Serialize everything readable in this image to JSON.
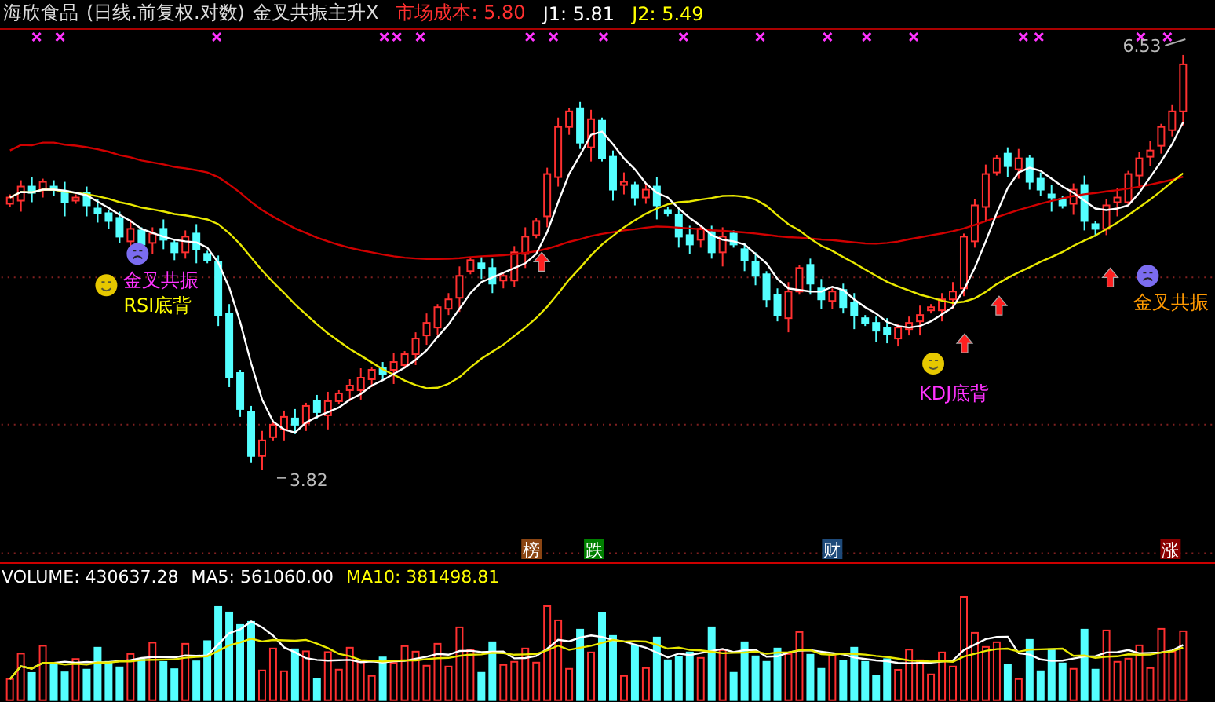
{
  "header": {
    "stock": "海欣食品",
    "period": "(日线.前复权.对数)",
    "indicator": "金叉共振主升X",
    "readings": [
      {
        "label": "市场成本:",
        "value": "5.80",
        "color": "#ff3030"
      },
      {
        "label": "J1:",
        "value": "5.81",
        "color": "#ffffff"
      },
      {
        "label": "J2:",
        "value": "5.49",
        "color": "#ffff00"
      }
    ]
  },
  "price_chart": {
    "high_label": "6.53",
    "low_label": "3.82",
    "signals": [
      {
        "text": "金叉共振",
        "kind": "sad",
        "color": "#ff33ff"
      },
      {
        "text": "RSI底背",
        "kind": "smile",
        "color": "#ffff00"
      },
      {
        "text": "KDJ底背",
        "kind": "smile",
        "color": "#ff33ff"
      },
      {
        "text": "金叉共振",
        "kind": "sad",
        "color": "#ff9900"
      }
    ],
    "badges": [
      {
        "text": "榜",
        "color": "#8b4513"
      },
      {
        "text": "跌",
        "color": "#008000"
      },
      {
        "text": "财",
        "color": "#1e4a7a"
      },
      {
        "text": "涨",
        "color": "#8b0000"
      }
    ]
  },
  "volume": {
    "readings": [
      {
        "label": "VOLUME:",
        "value": "430637.28",
        "color": "#ffffff"
      },
      {
        "label": "MA5:",
        "value": "561060.00",
        "color": "#ffffff"
      },
      {
        "label": "MA10:",
        "value": "381498.81",
        "color": "#ffff00"
      }
    ]
  }
}
